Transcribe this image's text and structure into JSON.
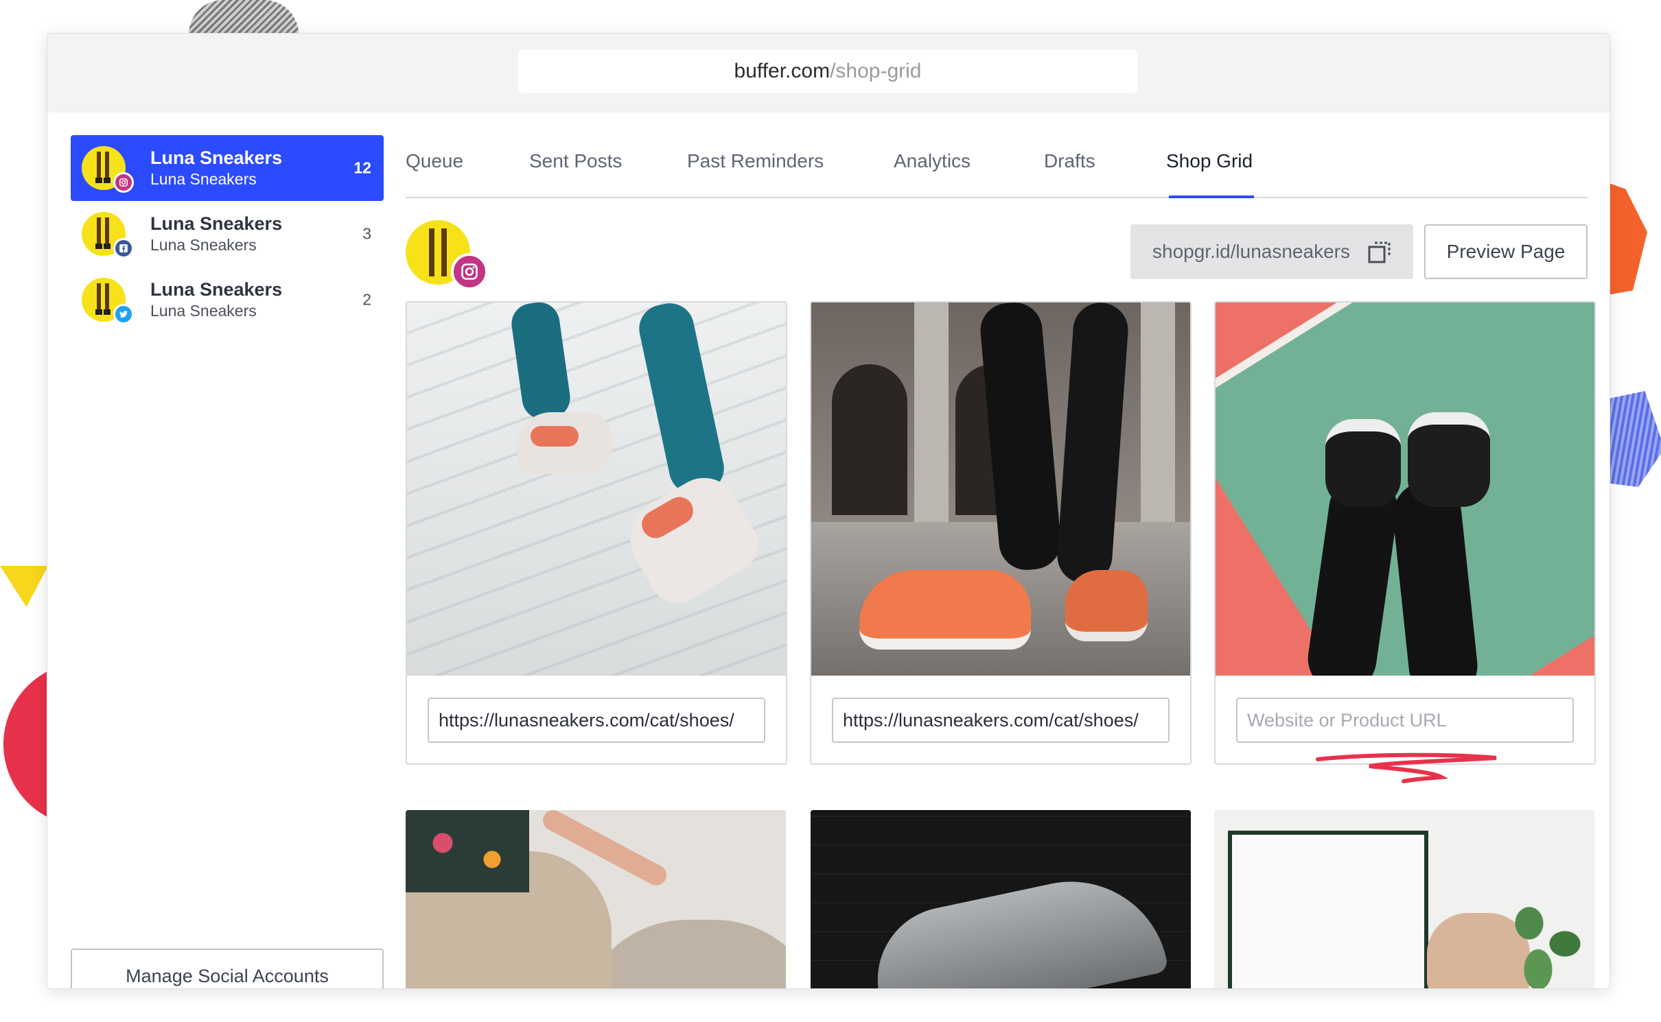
{
  "browser": {
    "url_domain": "buffer.com",
    "url_path": "/shop-grid"
  },
  "sidebar": {
    "accounts": [
      {
        "name": "Luna Sneakers",
        "handle": "Luna Sneakers",
        "count": "12",
        "network": "instagram-icon",
        "active": true
      },
      {
        "name": "Luna Sneakers",
        "handle": "Luna Sneakers",
        "count": "3",
        "network": "facebook-icon",
        "active": false
      },
      {
        "name": "Luna Sneakers",
        "handle": "Luna Sneakers",
        "count": "2",
        "network": "twitter-icon",
        "active": false
      }
    ],
    "manage_label": "Manage Social Accounts"
  },
  "tabs": [
    {
      "label": "Queue"
    },
    {
      "label": "Sent Posts"
    },
    {
      "label": "Past Reminders"
    },
    {
      "label": "Analytics"
    },
    {
      "label": "Drafts"
    },
    {
      "label": "Shop Grid",
      "active": true
    }
  ],
  "shop": {
    "link": "shopgr.id/lunasneakers",
    "preview_label": "Preview Page",
    "posts": [
      {
        "url": "https://lunasneakers.com/cat/shoes/",
        "placeholder": "Website or Product URL"
      },
      {
        "url": "https://lunasneakers.com/cat/shoes/",
        "placeholder": "Website or Product URL"
      },
      {
        "url": "",
        "placeholder": "Website or Product URL"
      }
    ]
  },
  "colors": {
    "accent": "#2c4bff",
    "instagram": "#c13584",
    "facebook": "#3b5998",
    "twitter": "#1da1f2"
  }
}
